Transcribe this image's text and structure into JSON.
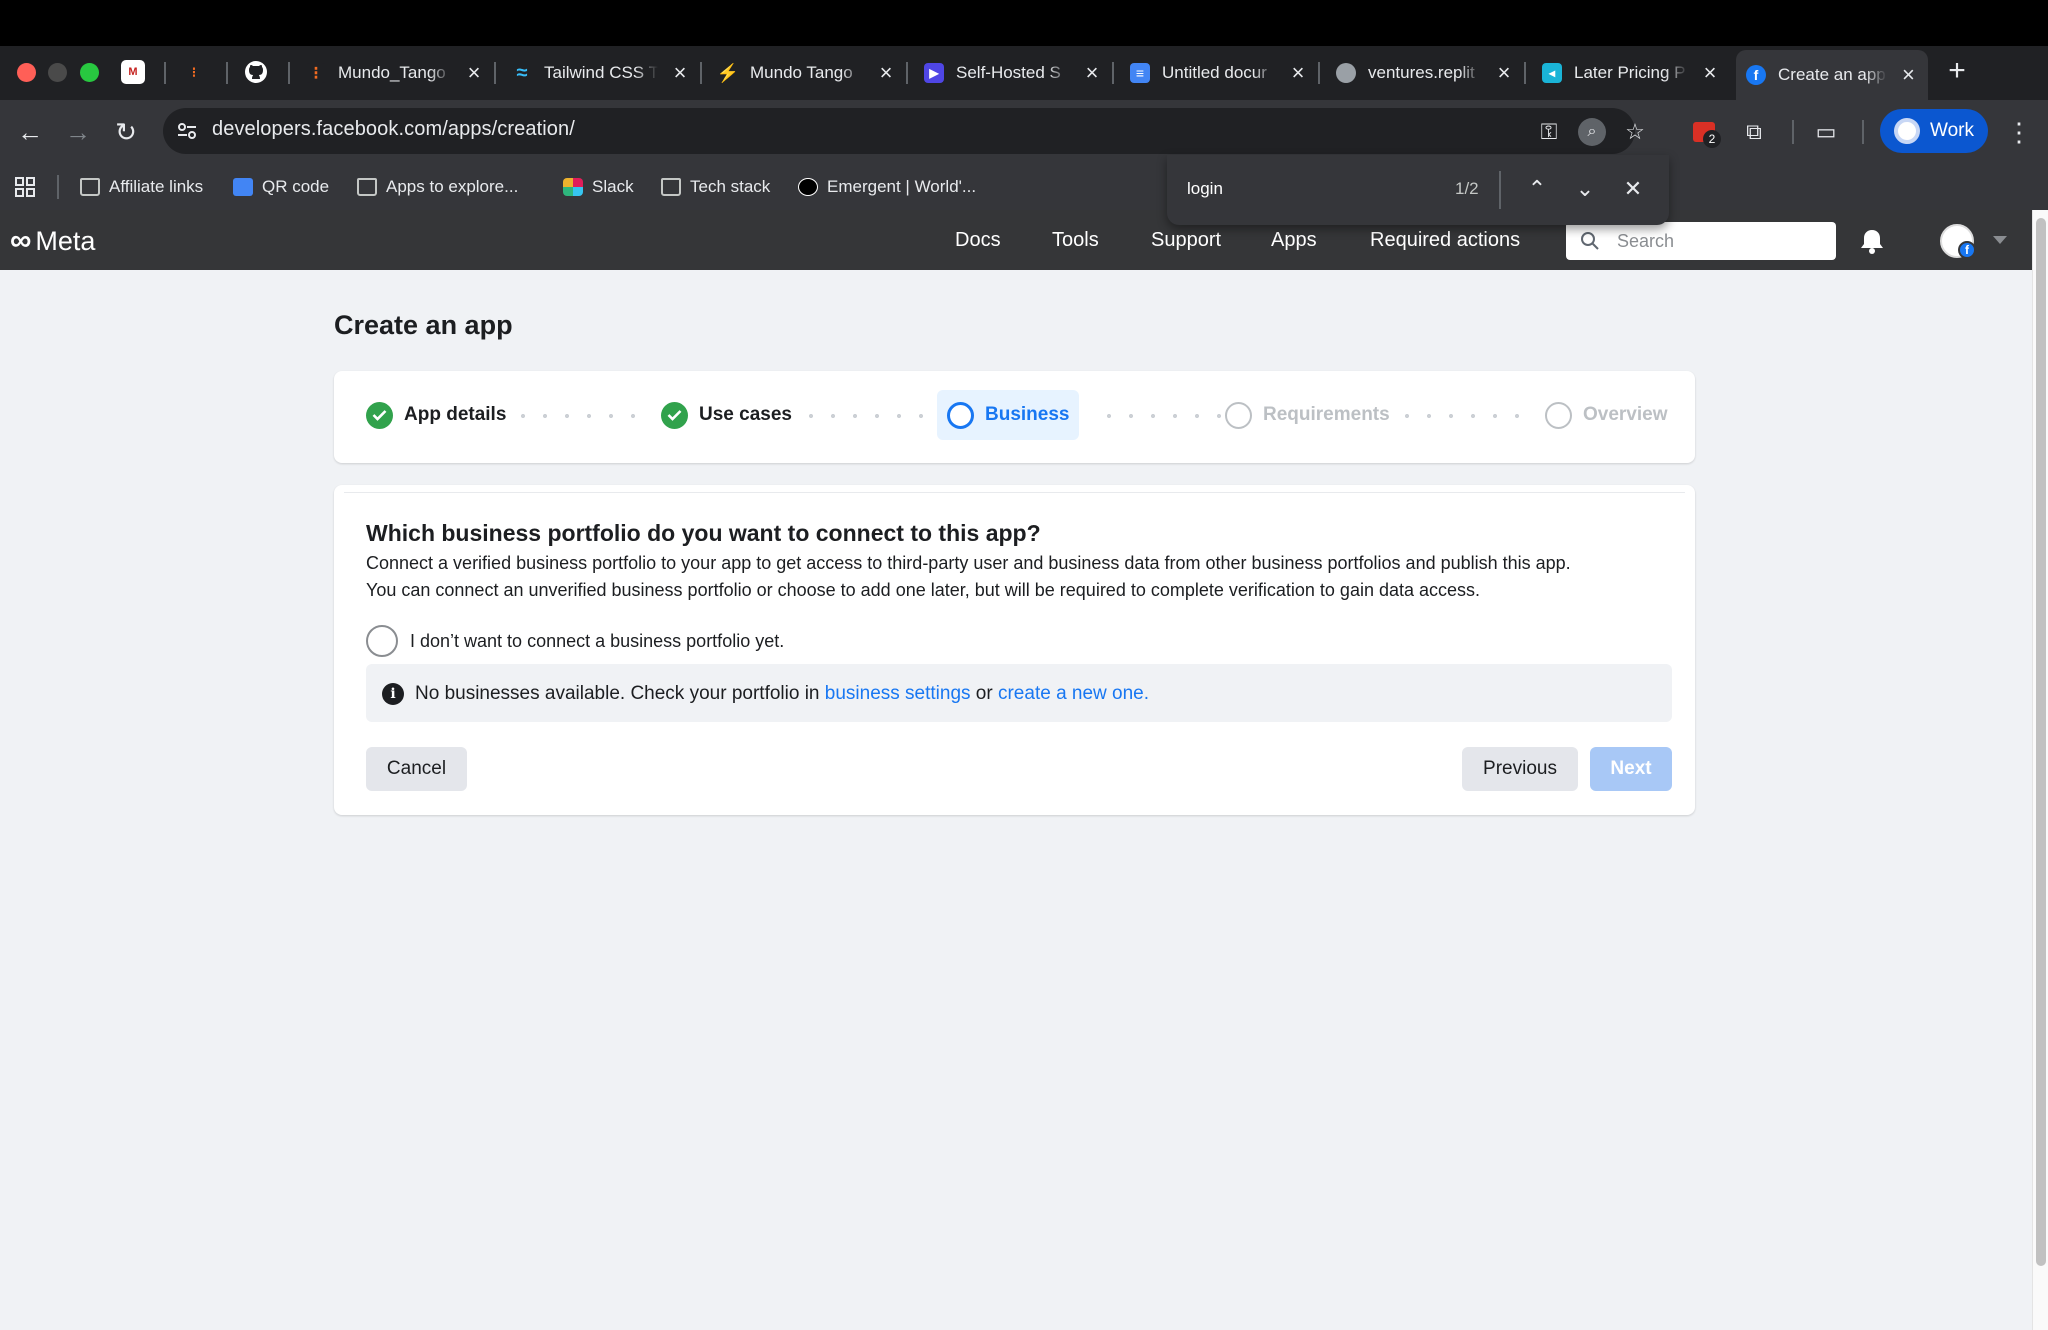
{
  "browser": {
    "tabs": [
      {
        "title": "Mundo_Tango",
        "color": "#f26b21"
      },
      {
        "title": "Tailwind CSS T",
        "color": "#38bdf8"
      },
      {
        "title": "Mundo Tango",
        "color": "#22c55e"
      },
      {
        "title": "Self-Hosted S",
        "color": "#4f46e5"
      },
      {
        "title": "Untitled docur",
        "color": "#4285f4"
      },
      {
        "title": "ventures.replit",
        "color": "#9aa0a6"
      },
      {
        "title": "Later Pricing P",
        "color": "#1ab4d7"
      },
      {
        "title": "Create an app",
        "color": "#1877f2"
      }
    ],
    "url": "developers.facebook.com/apps/creation/",
    "profile_label": "Work",
    "extension_badge": "2",
    "bookmarks": [
      "Affiliate links",
      "QR code",
      "Apps to explore...",
      "Slack",
      "Tech stack",
      "Emergent | World'..."
    ],
    "find": {
      "query": "login",
      "count": "1/2"
    }
  },
  "meta": {
    "logo_text": "Meta",
    "nav": [
      "Docs",
      "Tools",
      "Support",
      "Apps",
      "Required actions"
    ],
    "search_placeholder": "Search"
  },
  "page": {
    "title": "Create an app",
    "steps": [
      {
        "label": "App details",
        "state": "done"
      },
      {
        "label": "Use cases",
        "state": "done"
      },
      {
        "label": "Business",
        "state": "current"
      },
      {
        "label": "Requirements",
        "state": "pending"
      },
      {
        "label": "Overview",
        "state": "pending"
      }
    ],
    "question": "Which business portfolio do you want to connect to this app?",
    "description_1": "Connect a verified business portfolio to your app to get access to third-party user and business data from other business portfolios and publish this app.",
    "description_2": "You can connect an unverified business portfolio or choose to add one later, but will be required to complete verification to gain data access.",
    "radio_label": "I don’t want to connect a business portfolio yet.",
    "notice_prefix": "No businesses available. Check your portfolio in ",
    "notice_link1": "business settings",
    "notice_mid": " or ",
    "notice_link2": "create a new one.",
    "cancel_label": "Cancel",
    "previous_label": "Previous",
    "next_label": "Next"
  },
  "colors": {
    "accent": "#1877f2",
    "success": "#31a24c",
    "next_disabled": "#a8c8f6"
  }
}
